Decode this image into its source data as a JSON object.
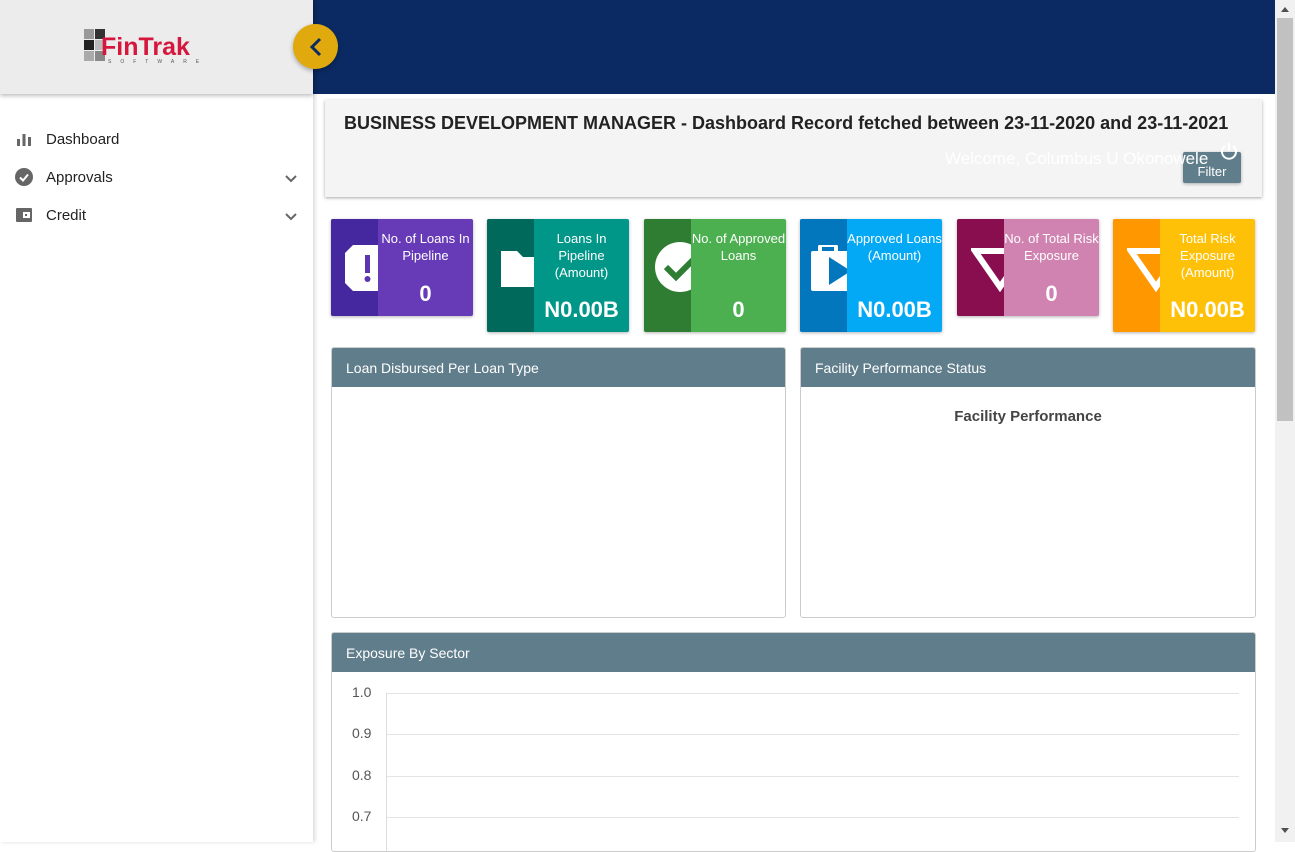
{
  "brand": {
    "name": "FinTrak",
    "sub": "SOFTWARE"
  },
  "sidebar": {
    "items": [
      {
        "label": "Dashboard",
        "icon": "bar-chart-icon"
      },
      {
        "label": "Approvals",
        "icon": "check-circle-icon"
      },
      {
        "label": "Credit",
        "icon": "wallet-icon"
      }
    ]
  },
  "header": {
    "title": "BUSINESS DEVELOPMENT MANAGER - Dashboard Record fetched between 23-11-2020 and 23-11-2021",
    "welcome": "Welcome, Columbus U Okonowele",
    "filter_label": "Filter"
  },
  "cards": [
    {
      "label": "No. of Loans In Pipeline",
      "value": "0",
      "dark": "#4527a0",
      "light": "#673ab7",
      "icon": "alert-tag-icon"
    },
    {
      "label": "Loans In Pipeline (Amount)",
      "value": "N0.00B",
      "dark": "#00695c",
      "light": "#009688",
      "icon": "folder-icon"
    },
    {
      "label": "No. of Approved Loans",
      "value": "0",
      "dark": "#2e7d32",
      "light": "#4caf50",
      "icon": "check-circle-icon"
    },
    {
      "label": "Approved Loans (Amount)",
      "value": "N0.00B",
      "dark": "#0277bd",
      "light": "#03a9f4",
      "icon": "briefcase-play-icon"
    },
    {
      "label": "No. of Total Risk Exposure",
      "value": "0",
      "dark": "#880e4f",
      "light": "#d083b0",
      "icon": "triangle-down-icon"
    },
    {
      "label": "Total Risk Exposure (Amount)",
      "value": "N0.00B",
      "dark": "#ff9800",
      "light": "#ffc107",
      "icon": "triangle-down-icon"
    }
  ],
  "panels": {
    "loan_disbursed": "Loan Disbursed Per Loan Type",
    "facility": "Facility Performance Status",
    "facility_chart_title": "Facility Performance",
    "exposure": "Exposure By Sector"
  },
  "chart_data": {
    "type": "bar",
    "title": "Exposure By Sector",
    "categories": [],
    "values": [],
    "yticks": [
      "1.0",
      "0.9",
      "0.8",
      "0.7"
    ],
    "ylim": [
      0.7,
      1.0
    ]
  }
}
